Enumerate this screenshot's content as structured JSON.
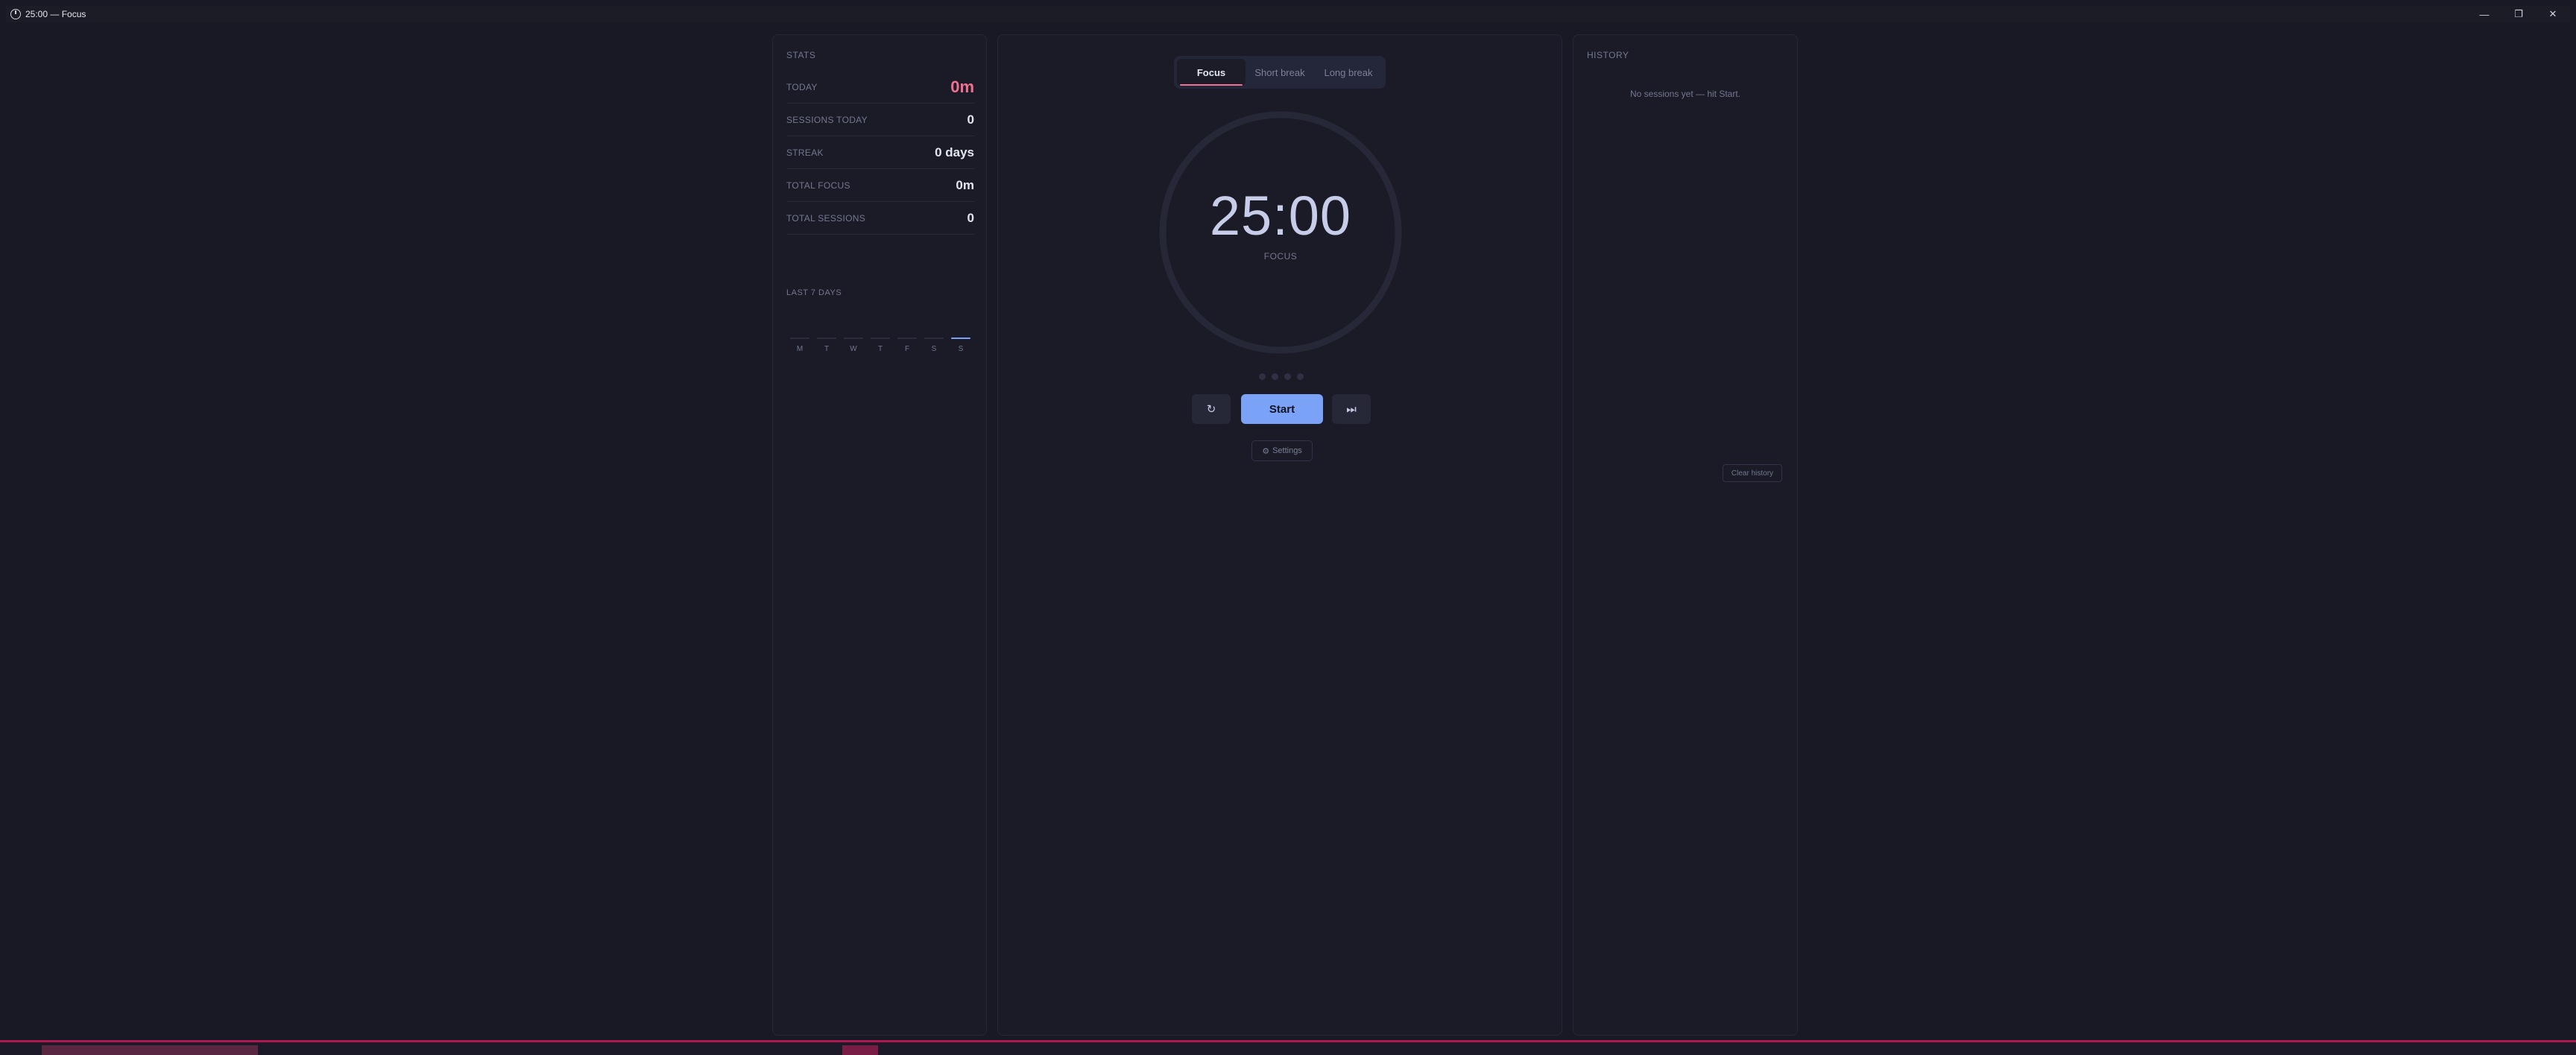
{
  "window": {
    "title": "25:00 — Focus",
    "controls": {
      "minimize": "—",
      "maximize": "❐",
      "close": "✕"
    }
  },
  "stats": {
    "heading": "STATS",
    "rows": [
      {
        "label": "TODAY",
        "value": "0m"
      },
      {
        "label": "SESSIONS TODAY",
        "value": "0"
      },
      {
        "label": "STREAK",
        "value": "0 days"
      },
      {
        "label": "TOTAL FOCUS",
        "value": "0m"
      },
      {
        "label": "TOTAL SESSIONS",
        "value": "0"
      }
    ],
    "chart_heading": "LAST 7 DAYS"
  },
  "chart_data": {
    "type": "bar",
    "title": "LAST 7 DAYS",
    "categories": [
      "M",
      "T",
      "W",
      "T",
      "F",
      "S",
      "S"
    ],
    "values": [
      0,
      0,
      0,
      0,
      0,
      0,
      0
    ],
    "highlight_index": 6
  },
  "timer": {
    "tabs": [
      {
        "label": "Focus",
        "active": true
      },
      {
        "label": "Short break",
        "active": false
      },
      {
        "label": "Long break",
        "active": false
      }
    ],
    "time": "25:00",
    "mode": "FOCUS",
    "progress": 0,
    "session_dots": 4,
    "start_label": "Start",
    "reset_icon": "↻",
    "skip_icon": "⏭",
    "settings_label": "Settings",
    "settings_icon": "⚙"
  },
  "history": {
    "heading": "HISTORY",
    "empty_message": "No sessions yet — hit Start.",
    "clear_label": "Clear history"
  },
  "colors": {
    "accent": "#f2708f",
    "primary": "#7aa2f7",
    "background": "#181924",
    "panel": "#1a1b26"
  }
}
